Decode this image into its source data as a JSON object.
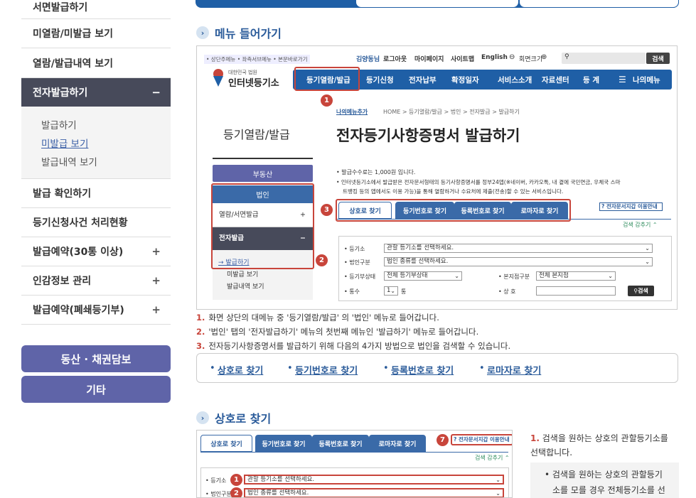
{
  "sidebar": {
    "top_partial": "서면발급하기",
    "items": [
      {
        "label": "미열람/미발급 보기"
      },
      {
        "label": "열람/발급내역 보기"
      },
      {
        "label": "전자발급하기",
        "toggle": "−"
      },
      {
        "label": "발급 확인하기"
      },
      {
        "label": "등기신청사건 처리현황"
      },
      {
        "label": "발급예약(30통 이상)",
        "toggle": "+"
      },
      {
        "label": "인감정보 관리",
        "toggle": "+"
      },
      {
        "label": "발급예약(폐쇄등기부)",
        "toggle": "+"
      }
    ],
    "sub": [
      "발급하기",
      "미발급 보기",
      "발급내역 보기"
    ],
    "buttons": [
      "동산 · 채권담보",
      "기타"
    ]
  },
  "section1": {
    "icon": "chevron-right-icon",
    "title": "메뉴 들어가기"
  },
  "shot": {
    "utility": "• 상단주메뉴 • 좌측서브메뉴 • 본문바로가기",
    "logo_small": "대한민국 법원",
    "logo": "인터넷등기소",
    "top_links": [
      "김양동님",
      "로그아웃",
      "마이페이지",
      "사이트맵",
      "English",
      "회면크기"
    ],
    "search_btn": "검색",
    "nav": [
      "등기열람/발급",
      "등기신청",
      "전자납부",
      "확정일자",
      "서비스소개",
      "자료센터",
      "등 계",
      "나의메뉴"
    ],
    "fav": "나의메뉴추가",
    "breadcrumb": "HOME > 등기열람/발급 > 법인 > 전자발급 > 발급하기",
    "side_title": "등기열람/발급",
    "main_title": "전자등기사항증명서 발급하기",
    "side_menu": [
      "부동산",
      "법인",
      "열람/서면발급",
      "전자발급",
      "→ 발급하기",
      "미발급 보기",
      "발급내역 보기"
    ],
    "info1": "• 발급수수료는 1,000원 입니다.",
    "info2": "• 인터넷등기소에서 발급받은 전자문서형태의 등기사항증명서를 정부24앱(※네이버, 카카오톡, 내 곁에 국민연금, 우체국 스마",
    "info3": "트뱅킹 등의 앱에서도 이용 가능)을 통해 열람하거나 수요처에 제출(전송)할 수 있는 서비스입니다.",
    "tabs": [
      "상호로 찾기",
      "등기번호로 찾기",
      "등록번호로 찾기",
      "로마자로 찾기"
    ],
    "help": "전자문서지갑 이용안내",
    "tip": "검색 감추기",
    "form": {
      "l1": "• 등기소",
      "v1": "관할 등기소를 선택하세요.",
      "l2": "• 법인구분",
      "v2": "법인 종류를 선택하세요.",
      "l3": "• 등기부상태",
      "v3": "전체 등기부상태",
      "l4": "• 본지점구분",
      "v4": "전체 본지점",
      "l5": "• 통수",
      "v5": "1",
      "unit": "통",
      "l6": "• 상 호",
      "btn": "검색"
    },
    "badges": [
      "1",
      "2",
      "3"
    ]
  },
  "instructions": [
    {
      "n": "1.",
      "t": "화면 상단의 대메뉴 중 '등기열람/발급' 의 '법인' 메뉴로 들어갑니다."
    },
    {
      "n": "2.",
      "t": "'법인' 탭의 '전자발급하기' 메뉴의 첫번째 메뉴인 '발급하기' 메뉴로 들어갑니다."
    },
    {
      "n": "3.",
      "t": "전자등기사항증명서를 발급하기 위해 다음의 4가지 방법으로 법인을 검색할 수 있습니다."
    }
  ],
  "methods": [
    "상호로 찾기",
    "등기번호로 찾기",
    "등록번호로 찾기",
    "로마자로 찾기"
  ],
  "section2": {
    "icon": "chevron-right-icon",
    "title": "상호로 찾기"
  },
  "shot2": {
    "tabs": [
      "상호로 찾기",
      "등기번호로 찾기",
      "등록번호로 찾기",
      "로마자로 찾기"
    ],
    "help": "전자문서지갑 이용안내",
    "tip": "검색 감추기",
    "l1": "• 등기소",
    "v1": "관할 등기소를 선택하세요.",
    "l2": "• 법인구분",
    "v2": "법인 종류를 선택하세요.",
    "badges": [
      "7",
      "1",
      "2"
    ]
  },
  "right": {
    "n": "1.",
    "line1": "검색을 원하는 상호의 관할등기소를",
    "line2": "선택합니다.",
    "bullet1": "• 검색을 원하는 상호의 관할등기",
    "bullet2": "소를 모를 경우 전체등기소를 선"
  }
}
